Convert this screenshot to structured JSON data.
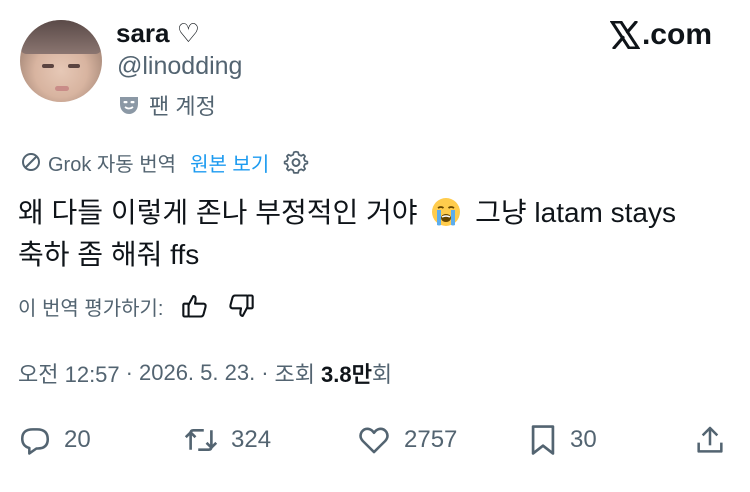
{
  "user": {
    "display_name": "sara ♡",
    "handle": "@linodding",
    "fan_label": "팬 계정"
  },
  "brand": {
    "logo_text": ".com"
  },
  "translation": {
    "auto_label": "Grok 자동 번역",
    "view_original": "원본 보기"
  },
  "tweet": {
    "line1_a": "왜 다들 이렇게 존나 부정적인 거야",
    "line1_b": "그냥 latam stays",
    "line2": "축하 좀 해줘 ffs",
    "emoji": "loudly-crying-face"
  },
  "rating": {
    "label": "이 번역 평가하기:"
  },
  "meta": {
    "time": "오전 12:57",
    "date": "2026. 5. 23.",
    "views_prefix": "조회",
    "views_count": "3.8만",
    "views_suffix": "회"
  },
  "actions": {
    "replies": "20",
    "reposts": "324",
    "likes": "2757",
    "bookmarks": "30"
  },
  "colors": {
    "link": "#1d9bf0",
    "muted": "#536471",
    "text": "#0f1419"
  }
}
